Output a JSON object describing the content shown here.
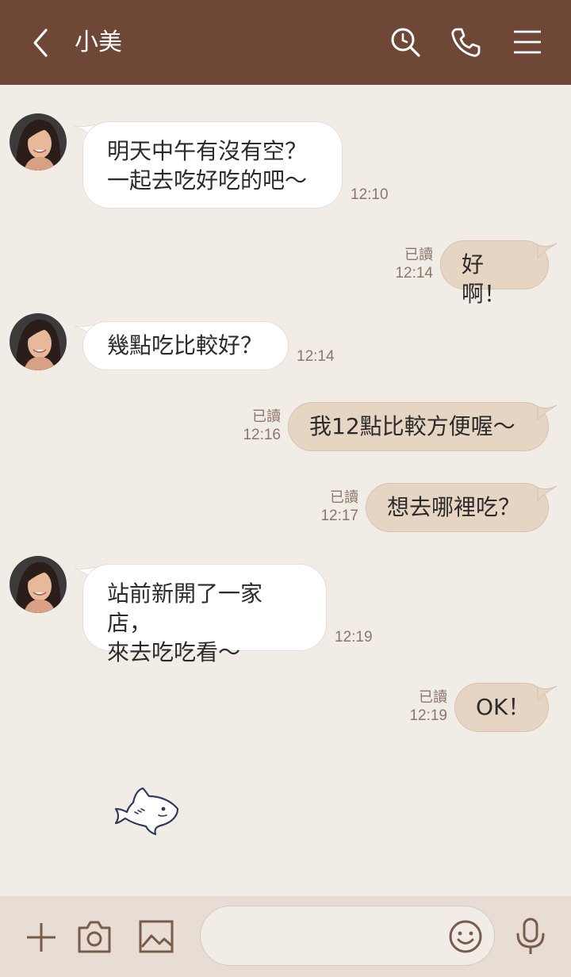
{
  "header": {
    "title": "小美",
    "back_icon": "chevron-left-icon",
    "search_icon": "search-icon",
    "call_icon": "phone-icon",
    "menu_icon": "menu-icon"
  },
  "messages": [
    {
      "side": "in",
      "text": "明天中午有沒有空？\n一起去吃好吃的吧～",
      "time": "12:10"
    },
    {
      "side": "out",
      "text": "好啊！",
      "read": "已讀",
      "time": "12:14"
    },
    {
      "side": "in",
      "text": "幾點吃比較好？",
      "time": "12:14"
    },
    {
      "side": "out",
      "text": "我12點比較方便喔～",
      "read": "已讀",
      "time": "12:16"
    },
    {
      "side": "out",
      "text": "想去哪裡吃？",
      "read": "已讀",
      "time": "12:17"
    },
    {
      "side": "in",
      "text": "站前新開了一家店，\n來去吃吃看～",
      "time": "12:19"
    },
    {
      "side": "out",
      "text": "OK！",
      "read": "已讀",
      "time": "12:19"
    }
  ],
  "sticker": {
    "icon": "fish-sticker-icon"
  },
  "inputbar": {
    "placeholder": "",
    "value": "",
    "icons": [
      "plus-icon",
      "camera-icon",
      "image-icon",
      "emoji-icon",
      "microphone-icon"
    ]
  },
  "colors": {
    "header_bg": "#6e4737",
    "chat_bg": "#f1ece6",
    "incoming_bubble": "#ffffff",
    "outgoing_bubble": "#e6d5c3",
    "inputbar_bg": "#e7ddd4"
  }
}
